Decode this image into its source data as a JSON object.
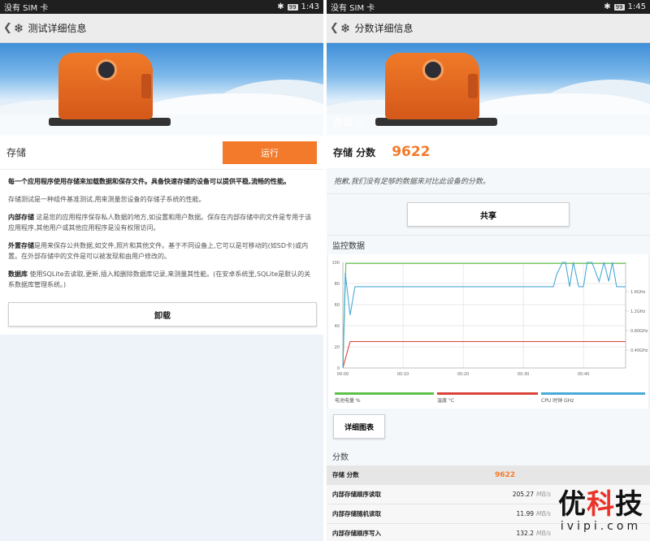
{
  "left": {
    "status": {
      "carrier": "没有 SIM 卡",
      "battery": "99",
      "time": "1:43"
    },
    "title": "测试详细信息",
    "test_name": "存储",
    "run_label": "运行",
    "desc": {
      "lead": "每一个应用程序使用存储来加载数据和保存文件。具备快速存储的设备可以提供平稳,流畅的性能。",
      "intro": "存储测试是一种组件基准测试,用来测量您设备的存储子系统的性能。",
      "internal_title": "内部存储",
      "internal_text": "这是您的应用程序保存私人数据的地方,如设置和用户数据。保存在内部存储中的文件是专用于该应用程序,其他用户或其他应用程序是没有权限访问。",
      "external_title": "外置存储",
      "external_text": "是用来保存公共数据,如文件,照片和其他文件。基于不同设备上,它可以是可移动的(如SD卡)或内置。在外部存储中的文件是可以被发现和由用户修改的。",
      "db_title": "数据库",
      "db_text": "使用SQLite去读取,更新,插入和删除数据库记录,来测量其性能。(在安卓系统里,SQLite是默认的关系数据库管理系统。)"
    },
    "uninstall_label": "卸载"
  },
  "right": {
    "status": {
      "carrier": "没有 SIM 卡",
      "battery": "99",
      "time": "1:45"
    },
    "title": "分数详细信息",
    "hero_label": "存储",
    "hero_version": "1.0",
    "score_label": "存储 分数",
    "score_value": "9622",
    "sorry": "抱歉,我们没有足够的数据来对比此设备的分数。",
    "share_label": "共享",
    "monitor_title": "监控数据",
    "detail_chart_label": "详细图表",
    "scores_title": "分数",
    "scores": [
      {
        "name": "存储 分数",
        "value": "9622",
        "unit": ""
      },
      {
        "name": "内部存储顺序读取",
        "value": "205.27",
        "unit": "MB/s"
      },
      {
        "name": "内部存储随机读取",
        "value": "11.99",
        "unit": "MB/s"
      },
      {
        "name": "内部存储顺序写入",
        "value": "132.2",
        "unit": "MB/s"
      }
    ]
  },
  "watermark": {
    "top_black1": "优",
    "top_red": "科",
    "top_black2": "技",
    "bottom": "ivipi.com"
  },
  "colors": {
    "accent": "#f37a2b",
    "battery_line": "#5ec24a",
    "temp_line": "#d9433a",
    "cpu_line": "#4aaad8"
  },
  "chart_data": {
    "type": "line",
    "x_ticks": [
      "00:00",
      "00:10",
      "00:20",
      "00:30",
      "00:40"
    ],
    "y_ticks_left": [
      "0",
      "20",
      "40",
      "60",
      "80",
      "100"
    ],
    "y_ticks_right": [
      "0.40GHz",
      "0.80GHz",
      "1.2GHz",
      "1.6GHz"
    ],
    "ylim": [
      0,
      100
    ],
    "xlim": [
      0,
      47
    ],
    "series": [
      {
        "name": "电池电量 %",
        "color": "#5ec24a",
        "x": [
          0,
          0.5,
          47
        ],
        "y": [
          0,
          99,
          99
        ]
      },
      {
        "name": "温度 °C",
        "color": "#d9433a",
        "x": [
          0,
          1.2,
          47
        ],
        "y": [
          0,
          25,
          25
        ]
      },
      {
        "name": "CPU 时钟 GHz",
        "color": "#4aaad8",
        "x": [
          0,
          0.4,
          1.2,
          2.0,
          35.0,
          35.5,
          36.5,
          37.0,
          37.7,
          38.3,
          39.2,
          40.0,
          40.6,
          41.4,
          42.6,
          43.4,
          44.2,
          44.8,
          45.5,
          46.0,
          47
        ],
        "y": [
          0,
          90,
          50,
          77,
          77,
          88,
          100,
          100,
          77,
          100,
          77,
          77,
          100,
          100,
          82,
          100,
          82,
          100,
          77,
          77,
          77
        ]
      }
    ]
  }
}
